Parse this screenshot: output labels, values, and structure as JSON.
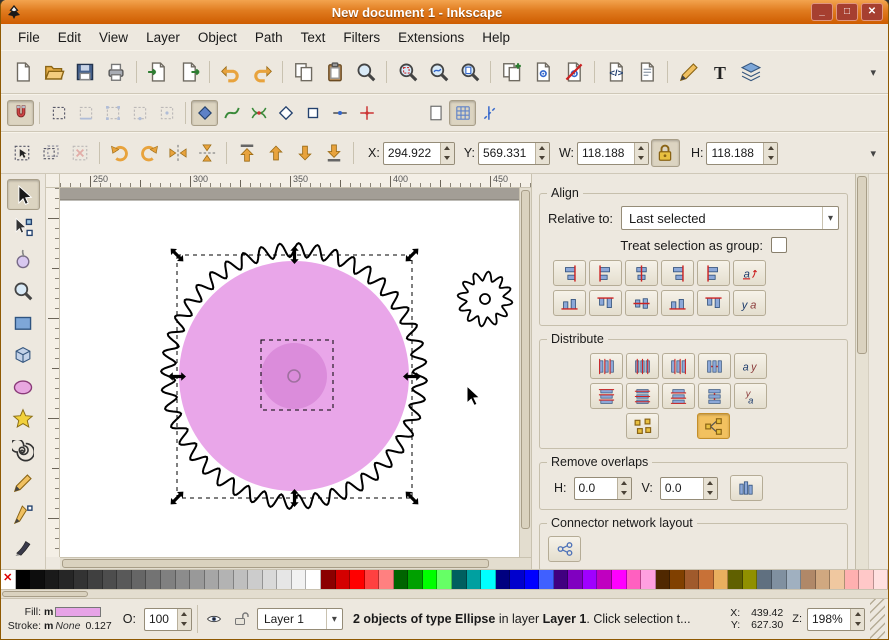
{
  "window": {
    "title": "New document 1 - Inkscape",
    "controls": [
      {
        "name": "minimize-button",
        "glyph": "_"
      },
      {
        "name": "maximize-button",
        "glyph": "□"
      },
      {
        "name": "close-button",
        "glyph": "✕"
      }
    ]
  },
  "glyphs": {
    "chevron": "▾",
    "dropdown_arrow": "▾",
    "none_swatch": "✕"
  },
  "menu": {
    "items": [
      "File",
      "Edit",
      "View",
      "Layer",
      "Object",
      "Path",
      "Text",
      "Filters",
      "Extensions",
      "Help"
    ]
  },
  "toolbar_main": {
    "buttons": [
      {
        "name": "new-document-button",
        "icon": "doc"
      },
      {
        "name": "open-document-button",
        "icon": "open"
      },
      {
        "name": "save-document-button",
        "icon": "save"
      },
      {
        "name": "print-document-button",
        "icon": "print"
      },
      {
        "sep": true
      },
      {
        "name": "import-button",
        "icon": "import"
      },
      {
        "name": "export-button",
        "icon": "export"
      },
      {
        "sep": true
      },
      {
        "name": "undo-button",
        "icon": "undo"
      },
      {
        "name": "redo-button",
        "icon": "redo"
      },
      {
        "sep": true
      },
      {
        "name": "copy-button",
        "icon": "copy"
      },
      {
        "name": "paste-button",
        "icon": "paste"
      },
      {
        "name": "find-button",
        "icon": "find"
      },
      {
        "sep": true
      },
      {
        "name": "zoom-to-selection-button",
        "icon": "zoomsel"
      },
      {
        "name": "zoom-to-drawing-button",
        "icon": "zoomdraw"
      },
      {
        "name": "zoom-to-page-button",
        "icon": "zoompage"
      },
      {
        "sep": true
      },
      {
        "name": "duplicate-button",
        "icon": "duplicate"
      },
      {
        "name": "create-clone-button",
        "icon": "clone"
      },
      {
        "name": "unlink-clone-button",
        "icon": "unlink"
      },
      {
        "sep": true
      },
      {
        "name": "xml-editor-button",
        "icon": "xml"
      },
      {
        "name": "document-properties-button",
        "icon": "docprops"
      },
      {
        "sep": true
      },
      {
        "name": "fill-and-stroke-button",
        "icon": "fillstroke"
      },
      {
        "name": "text-and-font-button",
        "icon": "textdlg"
      },
      {
        "name": "layers-dialog-button",
        "icon": "layers"
      }
    ]
  },
  "toolbar_snap": {
    "buttons": [
      {
        "name": "snap-enable-toggle",
        "icon": "magnet",
        "pressed": true
      },
      {
        "name": "snap-bounding-box-toggle",
        "icon": "bbox"
      },
      {
        "name": "snap-bbox-edges-toggle",
        "icon": "bboxedge",
        "disabled": true
      },
      {
        "name": "snap-bbox-corners-toggle",
        "icon": "bboxcorner",
        "disabled": true
      },
      {
        "name": "snap-bbox-edge-midpoints-toggle",
        "icon": "bboxmid",
        "disabled": true
      },
      {
        "name": "snap-bbox-centers-toggle",
        "icon": "bboxcenter",
        "disabled": true
      },
      {
        "name": "snap-nodes-toggle",
        "icon": "nodediamond",
        "pressed": true
      },
      {
        "name": "snap-to-paths-toggle",
        "icon": "pathcurve"
      },
      {
        "name": "snap-path-intersections-toggle",
        "icon": "pathx"
      },
      {
        "name": "snap-cusp-nodes-toggle",
        "icon": "diamondopen"
      },
      {
        "name": "snap-smooth-nodes-toggle",
        "icon": "squarenode"
      },
      {
        "name": "snap-line-midpoints-toggle",
        "icon": "midpoint"
      },
      {
        "name": "snap-object-centers-toggle",
        "icon": "objcenter"
      }
    ],
    "right_buttons": [
      {
        "name": "snap-page-border-toggle",
        "icon": "page"
      },
      {
        "name": "snap-grid-toggle",
        "icon": "grid",
        "pressed": true
      },
      {
        "name": "snap-guides-toggle",
        "icon": "guides"
      }
    ]
  },
  "tool_controls": {
    "select_buttons": [
      {
        "name": "select-all-button",
        "icon": "selectall"
      },
      {
        "name": "select-all-layers-button",
        "icon": "selectalllayers"
      },
      {
        "name": "deselect-button",
        "icon": "deselect",
        "disabled": true
      }
    ],
    "transform_buttons": [
      {
        "name": "rotate-90-ccw-button",
        "icon": "rotccw"
      },
      {
        "name": "rotate-90-cw-button",
        "icon": "rotcw"
      },
      {
        "name": "flip-horizontal-button",
        "icon": "fliph"
      },
      {
        "name": "flip-vertical-button",
        "icon": "flipv"
      }
    ],
    "zorder_buttons": [
      {
        "name": "raise-to-top-button",
        "icon": "raisetop"
      },
      {
        "name": "raise-button",
        "icon": "raise"
      },
      {
        "name": "lower-button",
        "icon": "lower"
      },
      {
        "name": "lower-to-bottom-button",
        "icon": "lowerbottom"
      }
    ],
    "fields": [
      {
        "name": "x-coordinate-spinbox",
        "label": "X:",
        "value": "294.922"
      },
      {
        "name": "y-coordinate-spinbox",
        "label": "Y:",
        "value": "569.331"
      },
      {
        "name": "width-spinbox",
        "label": "W:",
        "value": "118.188"
      }
    ],
    "lock": {
      "name": "lock-width-height-toggle",
      "icon": "lock",
      "pressed": true
    },
    "field_h": {
      "name": "height-spinbox",
      "label": "H:",
      "value": "118.188"
    }
  },
  "toolbox": {
    "tools": [
      {
        "name": "selector-tool",
        "icon": "cursor",
        "active": true
      },
      {
        "name": "node-editor-tool",
        "icon": "nodecursor"
      },
      {
        "name": "tweak-tool",
        "icon": "tweak"
      },
      {
        "name": "zoom-tool",
        "icon": "find"
      },
      {
        "name": "rectangle-tool",
        "icon": "recttool"
      },
      {
        "name": "box3d-tool",
        "icon": "cube"
      },
      {
        "name": "ellipse-tool",
        "icon": "ellipsetool"
      },
      {
        "name": "star-tool",
        "icon": "star"
      },
      {
        "name": "spiral-tool",
        "icon": "spiral"
      },
      {
        "name": "pencil-tool",
        "icon": "fillstroke"
      },
      {
        "name": "bezier-pen-tool",
        "icon": "pen"
      },
      {
        "name": "calligraphy-tool",
        "icon": "calligraphy"
      }
    ]
  },
  "ruler": {
    "h_labels": [
      "250",
      "300",
      "350",
      "400",
      "450"
    ]
  },
  "canvas": {
    "backdrop": "#A39E96",
    "page_color": "#FFFFFF",
    "gear_outline": "#000000",
    "circle_fill": "#E9A6E9",
    "center_fill": "#DB8CDB",
    "hole_stroke": "#A070A0",
    "selection_dash": "#000000"
  },
  "panel": {
    "align": {
      "title": "Align",
      "relative_label": "Relative to:",
      "relative_value": "Last selected",
      "group_label": "Treat selection as group:",
      "row1": [
        {
          "name": "align-right-to-anchor-left-button",
          "icon": "al1"
        },
        {
          "name": "align-left-edges-button",
          "icon": "al2"
        },
        {
          "name": "center-on-vertical-axis-button",
          "icon": "al3"
        },
        {
          "name": "align-right-edges-button",
          "icon": "al4"
        },
        {
          "name": "align-left-to-anchor-right-button",
          "icon": "al5"
        },
        {
          "name": "text-align-horizontal-button",
          "icon": "altexta"
        }
      ],
      "row2": [
        {
          "name": "align-bottom-to-anchor-top-button",
          "icon": "av1"
        },
        {
          "name": "align-top-edges-button",
          "icon": "av2"
        },
        {
          "name": "center-on-horizontal-axis-button",
          "icon": "av3"
        },
        {
          "name": "align-bottom-edges-button",
          "icon": "av4"
        },
        {
          "name": "align-top-to-anchor-bottom-button",
          "icon": "av5"
        },
        {
          "name": "text-align-vertical-button",
          "icon": "altextya"
        }
      ]
    },
    "distribute": {
      "title": "Distribute",
      "row1": [
        {
          "name": "distribute-left-edges-button",
          "icon": "d1"
        },
        {
          "name": "distribute-centers-horizontally-button",
          "icon": "d2"
        },
        {
          "name": "distribute-right-edges-button",
          "icon": "d3"
        },
        {
          "name": "distribute-equal-horizontal-gaps-button",
          "icon": "d4"
        },
        {
          "name": "text-distribute-horizontal-button",
          "icon": "dtexth"
        }
      ],
      "row2": [
        {
          "name": "distribute-top-edges-button",
          "icon": "dv1"
        },
        {
          "name": "distribute-centers-vertically-button",
          "icon": "dv2"
        },
        {
          "name": "distribute-bottom-edges-button",
          "icon": "dv3"
        },
        {
          "name": "distribute-equal-vertical-gaps-button",
          "icon": "dv4"
        },
        {
          "name": "text-distribute-vertical-button",
          "icon": "dtextv"
        }
      ],
      "row3": [
        {
          "name": "unclump-button",
          "icon": "unclump"
        },
        {
          "name": "rearrange-connector-network-button",
          "icon": "graph",
          "pressed": true
        }
      ]
    },
    "remove_overlaps": {
      "title": "Remove overlaps",
      "h_label": "H:",
      "h_value": "0.0",
      "v_label": "V:",
      "v_value": "0.0",
      "button": {
        "name": "remove-overlaps-button",
        "icon": "overlap"
      }
    },
    "connector": {
      "title": "Connector network layout",
      "button": {
        "name": "connector-network-layout-button",
        "icon": "network"
      }
    }
  },
  "palette": {
    "colors": [
      "none",
      "#000000",
      "#0d0d0d",
      "#1a1a1a",
      "#262626",
      "#333333",
      "#404040",
      "#4d4d4d",
      "#595959",
      "#666666",
      "#737373",
      "#808080",
      "#8c8c8c",
      "#999999",
      "#a6a6a6",
      "#b3b3b3",
      "#bfbfbf",
      "#cccccc",
      "#d9d9d9",
      "#e6e6e6",
      "#f2f2f2",
      "#ffffff",
      "#8b0000",
      "#d40000",
      "#ff0000",
      "#ff4040",
      "#ff8080",
      "#006400",
      "#00a000",
      "#00ff00",
      "#66ff66",
      "#005f5f",
      "#00a0a0",
      "#00ffff",
      "#000080",
      "#0000cd",
      "#0000ff",
      "#4060ff",
      "#400080",
      "#8000c0",
      "#a000ff",
      "#c000c0",
      "#ff00ff",
      "#ff60c0",
      "#ffa0e0",
      "#502800",
      "#804000",
      "#a05a2c",
      "#c87137",
      "#e9af5f",
      "#606000",
      "#909000",
      "#607080",
      "#8090a0",
      "#a0b0c0",
      "#b08868",
      "#d0a880",
      "#f0c8a0",
      "#ffb0b0",
      "#ffc8c8",
      "#ffe0e0"
    ]
  },
  "statusbar": {
    "fill_label": "Fill:",
    "fill_prefix": "m",
    "fill_color": "#E7A3E7",
    "stroke_label": "Stroke:",
    "stroke_prefix": "m",
    "stroke_value": "None",
    "stroke_width": "0.127",
    "opacity_label": "O:",
    "opacity_value": "100",
    "layer_name": "Layer 1",
    "message_segments": [
      {
        "text": "2 objects of type Ellipse",
        "bold": true
      },
      {
        "text": " in layer ",
        "bold": false
      },
      {
        "text": "Layer 1",
        "bold": true
      },
      {
        "text": ". Click selection t...",
        "bold": false
      }
    ],
    "x_label": "X:",
    "x_value": "439.42",
    "y_label": "Y:",
    "y_value": "627.30",
    "zoom_label": "Z:",
    "zoom_value": "198%"
  }
}
